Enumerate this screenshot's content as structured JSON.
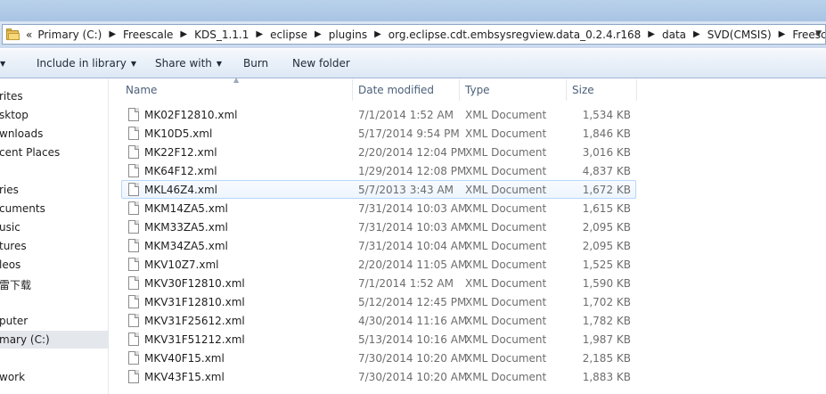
{
  "address_bar": {
    "overflow_chevron": "«",
    "breadcrumbs": [
      "Primary (C:)",
      "Freescale",
      "KDS_1.1.1",
      "eclipse",
      "plugins",
      "org.eclipse.cdt.embsysregview.data_0.2.4.r168",
      "data",
      "SVD(CMSIS)",
      "Freescale"
    ],
    "dropdown_icon": "chevron-down-icon"
  },
  "toolbar": {
    "include_in_library": "Include in library",
    "share_with": "Share with",
    "burn": "Burn",
    "new_folder": "New folder"
  },
  "nav": {
    "items": [
      "rites",
      "sktop",
      "wnloads",
      "cent Places",
      "ries",
      "cuments",
      "usic",
      "tures",
      "leos",
      "雷下载",
      "puter",
      "mary (C:)",
      "work"
    ]
  },
  "columns": {
    "name": "Name",
    "date_modified": "Date modified",
    "type": "Type",
    "size": "Size"
  },
  "files": [
    {
      "name": "MK02F12810.xml",
      "date": "7/1/2014 1:52 AM",
      "type": "XML Document",
      "size": "1,534 KB"
    },
    {
      "name": "MK10D5.xml",
      "date": "5/17/2014 9:54 PM",
      "type": "XML Document",
      "size": "1,846 KB"
    },
    {
      "name": "MK22F12.xml",
      "date": "2/20/2014 12:04 PM",
      "type": "XML Document",
      "size": "3,016 KB"
    },
    {
      "name": "MK64F12.xml",
      "date": "1/29/2014 12:08 PM",
      "type": "XML Document",
      "size": "4,837 KB"
    },
    {
      "name": "MKL46Z4.xml",
      "date": "5/7/2013 3:43 AM",
      "type": "XML Document",
      "size": "1,672 KB"
    },
    {
      "name": "MKM14ZA5.xml",
      "date": "7/31/2014 10:03 AM",
      "type": "XML Document",
      "size": "1,615 KB"
    },
    {
      "name": "MKM33ZA5.xml",
      "date": "7/31/2014 10:03 AM",
      "type": "XML Document",
      "size": "2,095 KB"
    },
    {
      "name": "MKM34ZA5.xml",
      "date": "7/31/2014 10:04 AM",
      "type": "XML Document",
      "size": "2,095 KB"
    },
    {
      "name": "MKV10Z7.xml",
      "date": "2/20/2014 11:05 AM",
      "type": "XML Document",
      "size": "1,525 KB"
    },
    {
      "name": "MKV30F12810.xml",
      "date": "7/1/2014 1:52 AM",
      "type": "XML Document",
      "size": "1,590 KB"
    },
    {
      "name": "MKV31F12810.xml",
      "date": "5/12/2014 12:45 PM",
      "type": "XML Document",
      "size": "1,702 KB"
    },
    {
      "name": "MKV31F25612.xml",
      "date": "4/30/2014 11:16 AM",
      "type": "XML Document",
      "size": "1,782 KB"
    },
    {
      "name": "MKV31F51212.xml",
      "date": "5/13/2014 10:16 AM",
      "type": "XML Document",
      "size": "1,987 KB"
    },
    {
      "name": "MKV40F15.xml",
      "date": "7/30/2014 10:20 AM",
      "type": "XML Document",
      "size": "2,185 KB"
    },
    {
      "name": "MKV43F15.xml",
      "date": "7/30/2014 10:20 AM",
      "type": "XML Document",
      "size": "1,883 KB"
    }
  ],
  "hovered_row": "MKL46Z4.xml"
}
